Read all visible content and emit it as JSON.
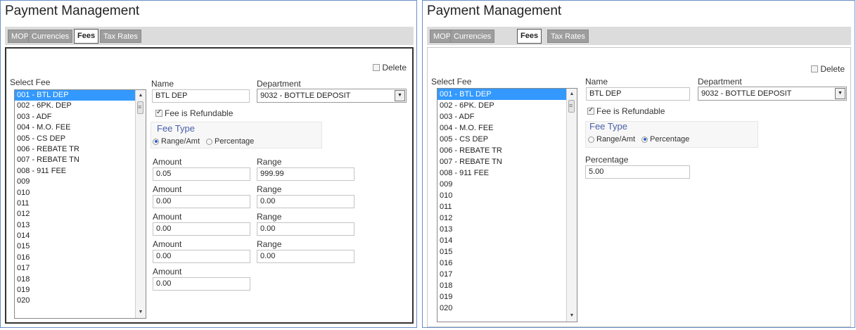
{
  "title": "Payment Management",
  "tabs": [
    "MOP",
    "Currencies",
    "Fees",
    "Tax Rates"
  ],
  "active_tab": "Fees",
  "delete_label": "Delete",
  "select_fee_label": "Select Fee",
  "fee_list": [
    "001 - BTL DEP",
    "002 - 6PK. DEP",
    "003 - ADF",
    "004 - M.O. FEE",
    "005 - CS DEP",
    "006 - REBATE TR",
    "007 - REBATE TN",
    "008 - 911 FEE",
    "009",
    "010",
    "011",
    "012",
    "013",
    "014",
    "015",
    "016",
    "017",
    "018",
    "019",
    "020"
  ],
  "selected_fee": "001 - BTL DEP",
  "name_label": "Name",
  "name_value": "BTL DEP",
  "department_label": "Department",
  "department_value": "9032 - BOTTLE DEPOSIT",
  "refundable_label": "Fee is Refundable",
  "refundable_checked": true,
  "fee_type_label": "Fee Type",
  "radio_range": "Range/Amt",
  "radio_percentage": "Percentage",
  "left_panel": {
    "fee_type_selected": "Range/Amt",
    "amount_label": "Amount",
    "range_label": "Range",
    "rows": [
      {
        "amount": "0.05",
        "range": "999.99"
      },
      {
        "amount": "0.00",
        "range": "0.00"
      },
      {
        "amount": "0.00",
        "range": "0.00"
      },
      {
        "amount": "0.00",
        "range": "0.00"
      },
      {
        "amount": "0.00"
      }
    ]
  },
  "right_panel": {
    "fee_type_selected": "Percentage",
    "percentage_label": "Percentage",
    "percentage_value": "5.00"
  },
  "colors": {
    "list_selection": "#3399ff",
    "fee_type_title": "#4a5fa8",
    "panel_border": "#6b8fc4"
  },
  "icons": [
    "checkbox",
    "radio",
    "scroll-up-arrow",
    "scroll-down-arrow",
    "dropdown-arrow"
  ]
}
